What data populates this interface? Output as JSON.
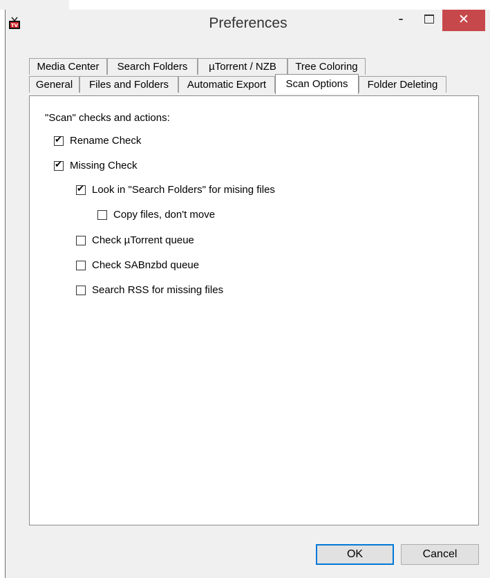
{
  "window": {
    "title": "Preferences",
    "app_icon": "tv-icon",
    "minimize": "-",
    "close": "✕"
  },
  "tabs_row1": [
    "Media Center",
    "Search Folders",
    "µTorrent / NZB",
    "Tree Coloring"
  ],
  "tabs_row2": [
    "General",
    "Files and Folders",
    "Automatic Export",
    "Scan Options",
    "Folder Deleting"
  ],
  "active_tab": "Scan Options",
  "scan": {
    "section_label": "\"Scan\" checks and actions:",
    "options": [
      {
        "label": "Rename Check",
        "checked": true
      },
      {
        "label": "Missing Check",
        "checked": true
      },
      {
        "label": "Look in \"Search Folders\" for mising files",
        "checked": true
      },
      {
        "label": "Copy files, don't move",
        "checked": false
      },
      {
        "label": "Check µTorrent queue",
        "checked": false
      },
      {
        "label": "Check SABnzbd queue",
        "checked": false
      },
      {
        "label": "Search RSS for missing files",
        "checked": false
      }
    ]
  },
  "buttons": {
    "ok": "OK",
    "cancel": "Cancel"
  },
  "colors": {
    "close_button": "#c7484b",
    "default_button_border": "#0078d7",
    "panel_bg": "#ffffff",
    "dialog_bg": "#f0f0f0"
  }
}
